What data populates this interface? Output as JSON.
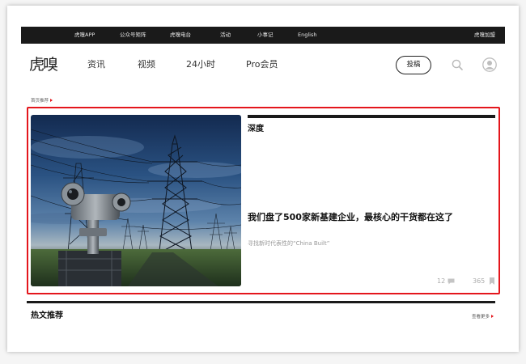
{
  "top_bar": {
    "items": [
      "虎嗅APP",
      "公众号矩阵",
      "虎嗅电台",
      "活动",
      "小事记",
      "English"
    ],
    "right": "虎嗅加盟"
  },
  "header": {
    "logo": "虎嗅",
    "nav": [
      "资讯",
      "视频",
      "24小时",
      "Pro会员"
    ],
    "submit_label": "投稿"
  },
  "section_label": "首页推荐",
  "featured": {
    "category": "深度",
    "title": "我们盘了500家新基建企业，最核心的干货都在这了",
    "summary": "寻找新时代表性的“China Built”",
    "comments": "12",
    "favorites": "365"
  },
  "hot": {
    "title": "热文推荐",
    "more": "查看更多"
  },
  "icons": {
    "search": "search-icon",
    "avatar": "user-avatar-icon",
    "comments": "comment-icon",
    "favorites": "bookmark-icon",
    "more": "arrow-right-icon"
  },
  "colors": {
    "accent": "#e4161c",
    "bar": "#1a1a1a",
    "muted": "#999999"
  }
}
